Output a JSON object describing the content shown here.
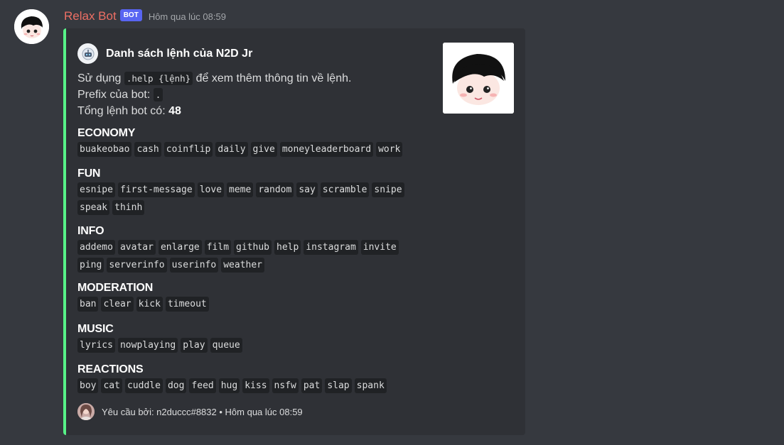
{
  "message": {
    "username": "Relax Bot",
    "bot_tag": "BOT",
    "timestamp": "Hôm qua lúc 08:59"
  },
  "embed": {
    "author_name": "Danh sách lệnh của N2D Jr",
    "description": {
      "line1_pre": "Sử dụng ",
      "line1_code": ".help {lệnh}",
      "line1_post": " để xem thêm thông tin về lệnh.",
      "line2_pre": "Prefix của bot: ",
      "line2_code": ".",
      "line3_pre": "Tổng lệnh bot có: ",
      "line3_value": "48"
    },
    "sections": [
      {
        "title": "ECONOMY",
        "commands": [
          "buakeobao",
          "cash",
          "coinflip",
          "daily",
          "give",
          "moneyleaderboard",
          "work"
        ]
      },
      {
        "title": "FUN",
        "commands": [
          "esnipe",
          "first-message",
          "love",
          "meme",
          "random",
          "say",
          "scramble",
          "snipe",
          "speak",
          "thinh"
        ]
      },
      {
        "title": "INFO",
        "commands": [
          "addemo",
          "avatar",
          "enlarge",
          "film",
          "github",
          "help",
          "instagram",
          "invite",
          "ping",
          "serverinfo",
          "userinfo",
          "weather"
        ]
      },
      {
        "title": "MODERATION",
        "commands": [
          "ban",
          "clear",
          "kick",
          "timeout"
        ]
      },
      {
        "title": "MUSIC",
        "commands": [
          "lyrics",
          "nowplaying",
          "play",
          "queue"
        ]
      },
      {
        "title": "REACTIONS",
        "commands": [
          "boy",
          "cat",
          "cuddle",
          "dog",
          "feed",
          "hug",
          "kiss",
          "nsfw",
          "pat",
          "slap",
          "spank"
        ]
      }
    ],
    "footer_text": "Yêu cầu bởi: n2duccc#8832 • Hôm qua lúc 08:59"
  },
  "colors": {
    "background": "#36393f",
    "embed_background": "#2f3136",
    "embed_border": "#57f287",
    "username": "#ed6f64",
    "bot_tag": "#5865f2"
  },
  "icons": {
    "bot_avatar": "cartoon-boy-avatar-icon",
    "author_icon": "bot-face-icon",
    "footer_avatar": "user-avatar-icon"
  }
}
